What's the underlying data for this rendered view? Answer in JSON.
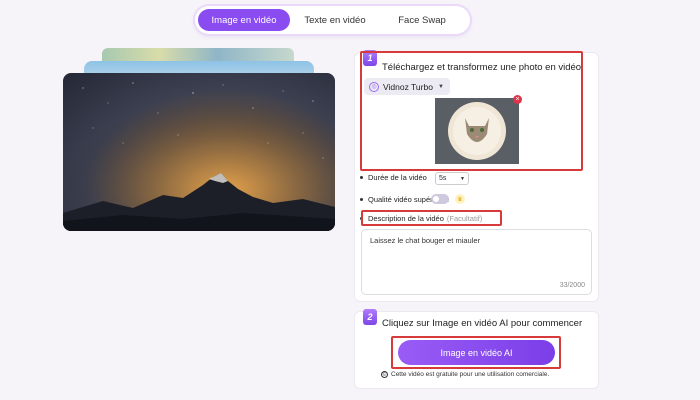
{
  "tabs": [
    {
      "label": "Image en vidéo",
      "active": true
    },
    {
      "label": "Texte en vidéo",
      "active": false
    },
    {
      "label": "Face Swap",
      "active": false
    }
  ],
  "step1": {
    "number": "1",
    "title": "Téléchargez et transformez une photo en vidéo",
    "model_label": "Vidnoz Turbo",
    "remove_icon": "close-icon"
  },
  "options": {
    "duration_label": "Durée de la vidéo",
    "duration_value": "5s",
    "quality_label": "Qualité vidéo supérieure",
    "quality_enabled": false,
    "description_label": "Description de la vidéo",
    "description_optional": "(Facultatif)",
    "description_text": "Laissez le chat bouger et miauler",
    "description_count": "33/2000"
  },
  "step2": {
    "number": "2",
    "title": "Cliquez sur Image en vidéo AI pour commencer",
    "button_label": "Image en vidéo AI",
    "footnote": "Cette vidéo est gratuite pour une utilisation comerciale."
  },
  "colors": {
    "accent": "#8a4bf0",
    "highlight": "#d63a3a"
  }
}
